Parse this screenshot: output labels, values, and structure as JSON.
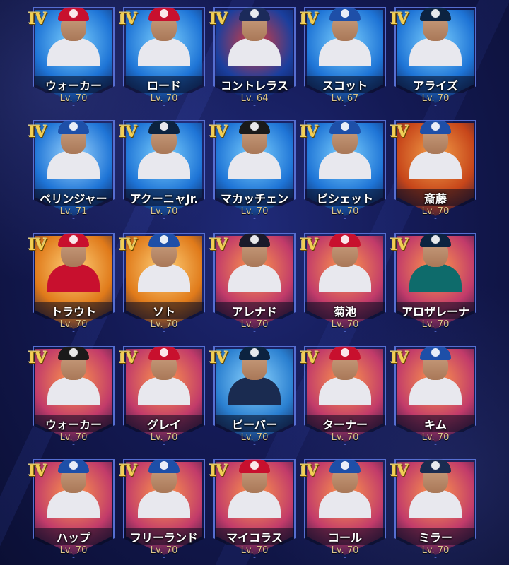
{
  "cards": [
    {
      "rank": "IV",
      "name": "ウォーカー",
      "level": "Lv. 70",
      "bg": "#1e74d6",
      "bg2": "#7fd3ff",
      "cap": "#c8102e",
      "shirt": "#e8e8ee"
    },
    {
      "rank": "IV",
      "name": "ロード",
      "level": "Lv. 70",
      "bg": "#1e74d6",
      "bg2": "#7fd3ff",
      "cap": "#c8102e",
      "shirt": "#e8e8ee"
    },
    {
      "rank": "IV",
      "name": "コントレラス",
      "level": "Lv. 64",
      "bg": "#1a3f9e",
      "bg2": "#e03b3b",
      "cap": "#1b2a5a",
      "shirt": "#e8e8ee"
    },
    {
      "rank": "IV",
      "name": "スコット",
      "level": "Lv. 67",
      "bg": "#1e74d6",
      "bg2": "#7fd3ff",
      "cap": "#1e4fa8",
      "shirt": "#e8e8ee"
    },
    {
      "rank": "IV",
      "name": "アライズ",
      "level": "Lv. 70",
      "bg": "#1e74d6",
      "bg2": "#7fd3ff",
      "cap": "#0c2340",
      "shirt": "#e8e8ee"
    },
    {
      "rank": "IV",
      "name": "ベリンジャー",
      "level": "Lv. 71",
      "bg": "#1e74d6",
      "bg2": "#9fd8ff",
      "cap": "#1e4fa8",
      "shirt": "#e8e8ee"
    },
    {
      "rank": "IV",
      "name": "アクーニャJr.",
      "level": "Lv. 70",
      "bg": "#1e74d6",
      "bg2": "#7fd3ff",
      "cap": "#0c2340",
      "shirt": "#e8e8ee"
    },
    {
      "rank": "IV",
      "name": "マカッチェン",
      "level": "Lv. 70",
      "bg": "#1e74d6",
      "bg2": "#7fd3ff",
      "cap": "#1a1a1a",
      "shirt": "#e8e8ee"
    },
    {
      "rank": "IV",
      "name": "ビシェット",
      "level": "Lv. 70",
      "bg": "#1e74d6",
      "bg2": "#7fd3ff",
      "cap": "#1e4fa8",
      "shirt": "#e8e8ee"
    },
    {
      "rank": "IV",
      "name": "斎藤",
      "level": "Lv. 70",
      "bg": "#c7461a",
      "bg2": "#f4a24a",
      "cap": "#1e4fa8",
      "shirt": "#e8e8ee"
    },
    {
      "rank": "IV",
      "name": "トラウト",
      "level": "Lv. 70",
      "bg": "#e07a1a",
      "bg2": "#ffd27a",
      "cap": "#c8102e",
      "shirt": "#c8102e"
    },
    {
      "rank": "IV",
      "name": "ソト",
      "level": "Lv. 70",
      "bg": "#e07a1a",
      "bg2": "#ffd27a",
      "cap": "#1e4fa8",
      "shirt": "#e8e8ee"
    },
    {
      "rank": "IV",
      "name": "アレナド",
      "level": "Lv. 70",
      "bg": "#c23b6a",
      "bg2": "#ff9a4a",
      "cap": "#1a1a2a",
      "shirt": "#e8e8ee"
    },
    {
      "rank": "IV",
      "name": "菊池",
      "level": "Lv. 70",
      "bg": "#c23b6a",
      "bg2": "#ff9a4a",
      "cap": "#c8102e",
      "shirt": "#e8e8ee"
    },
    {
      "rank": "IV",
      "name": "アロザレーナ",
      "level": "Lv. 70",
      "bg": "#c23b6a",
      "bg2": "#ff9a4a",
      "cap": "#0c2340",
      "shirt": "#0e6b6b"
    },
    {
      "rank": "IV",
      "name": "ウォーカー",
      "level": "Lv. 70",
      "bg": "#c23b6a",
      "bg2": "#ff9a4a",
      "cap": "#1a1a1a",
      "shirt": "#e8e8ee"
    },
    {
      "rank": "IV",
      "name": "グレイ",
      "level": "Lv. 70",
      "bg": "#c23b6a",
      "bg2": "#ff9a4a",
      "cap": "#c8102e",
      "shirt": "#e8e8ee"
    },
    {
      "rank": "IV",
      "name": "ビーバー",
      "level": "Lv. 70",
      "bg": "#2a7fd0",
      "bg2": "#8fd6ff",
      "cap": "#0c2340",
      "shirt": "#1a2b50"
    },
    {
      "rank": "IV",
      "name": "ターナー",
      "level": "Lv. 70",
      "bg": "#c23b6a",
      "bg2": "#ff9a4a",
      "cap": "#c8102e",
      "shirt": "#e8e8ee"
    },
    {
      "rank": "IV",
      "name": "キム",
      "level": "Lv. 70",
      "bg": "#c23b6a",
      "bg2": "#ff9a4a",
      "cap": "#1e4fa8",
      "shirt": "#e8e8ee"
    },
    {
      "rank": "IV",
      "name": "ハップ",
      "level": "Lv. 70",
      "bg": "#c23b6a",
      "bg2": "#ff9a4a",
      "cap": "#1e4fa8",
      "shirt": "#e8e8ee"
    },
    {
      "rank": "IV",
      "name": "フリーランド",
      "level": "Lv. 70",
      "bg": "#c23b6a",
      "bg2": "#ff9a4a",
      "cap": "#1e4fa8",
      "shirt": "#e8e8ee"
    },
    {
      "rank": "IV",
      "name": "マイコラス",
      "level": "Lv. 70",
      "bg": "#c23b6a",
      "bg2": "#ff9a4a",
      "cap": "#c8102e",
      "shirt": "#e8e8ee"
    },
    {
      "rank": "IV",
      "name": "コール",
      "level": "Lv. 70",
      "bg": "#c23b6a",
      "bg2": "#ff9a4a",
      "cap": "#1e4fa8",
      "shirt": "#e8e8ee"
    },
    {
      "rank": "IV",
      "name": "ミラー",
      "level": "Lv. 70",
      "bg": "#c23b6a",
      "bg2": "#ff9a4a",
      "cap": "#1a2b50",
      "shirt": "#e8e8ee"
    }
  ]
}
